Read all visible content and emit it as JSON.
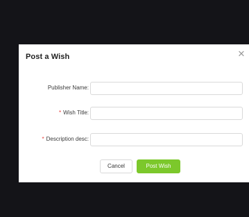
{
  "dialog": {
    "title": "Post a Wish",
    "close_icon": "close-icon"
  },
  "form": {
    "fields": [
      {
        "label": "Publisher Name",
        "required": false,
        "value": "",
        "placeholder": ""
      },
      {
        "label": "Wish Title",
        "required": true,
        "value": "",
        "placeholder": ""
      },
      {
        "label": "Description desc",
        "required": true,
        "value": "",
        "placeholder": ""
      }
    ],
    "separator": ":",
    "required_mark": "*"
  },
  "buttons": {
    "cancel_label": "Cancel",
    "submit_label": "Post Wish"
  },
  "colors": {
    "backdrop": "#141418",
    "accent": "#7cc82b",
    "required": "#e53935"
  }
}
